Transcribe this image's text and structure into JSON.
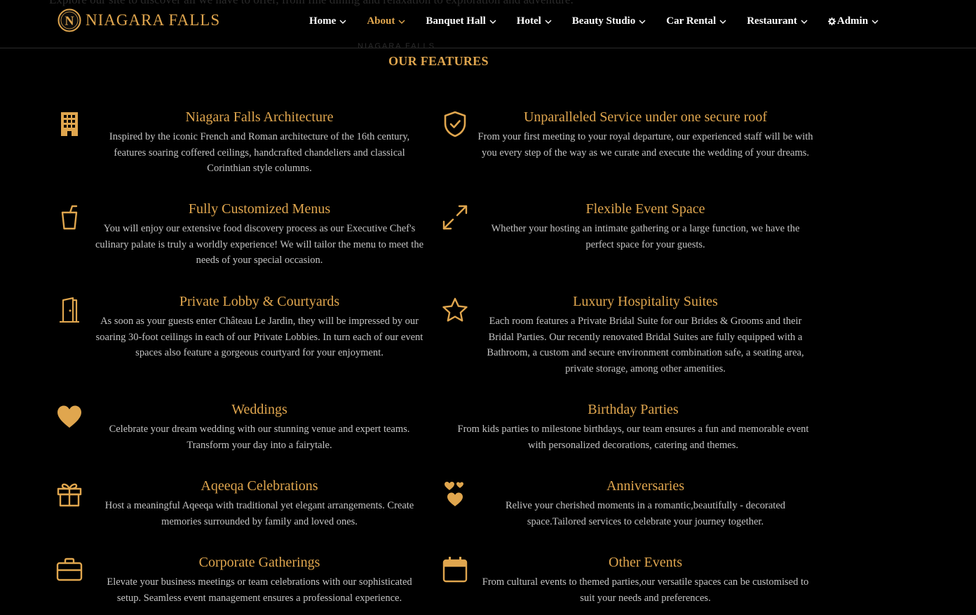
{
  "ghost": {
    "top_text": "Explore our site to discover all we have to offer, from fine dining and relaxation to exploration and adventure.",
    "section_subtitle": "NIAGARA FALLS"
  },
  "brand": {
    "name": "NIAGARA FALLS",
    "logo_letter": "N"
  },
  "nav": [
    {
      "label": "Home"
    },
    {
      "label": "About"
    },
    {
      "label": "Banquet Hall"
    },
    {
      "label": "Hotel"
    },
    {
      "label": "Beauty Studio"
    },
    {
      "label": "Car Rental"
    },
    {
      "label": "Restaurant"
    },
    {
      "label": "Admin"
    }
  ],
  "section": {
    "title": "OUR FEATURES"
  },
  "features": [
    {
      "icon": "building-icon",
      "title": "Niagara Falls Architecture",
      "text": "Inspired by the iconic French and Roman architecture of the 16th century, features soaring coffered ceilings, handcrafted chandeliers and classical Corinthian style columns."
    },
    {
      "icon": "shield-check-icon",
      "title": "Unparalleled Service under one secure roof",
      "text": "From your first meeting to your royal departure, our experienced staff will be with you every step of the way as we curate and execute the wedding of your dreams."
    },
    {
      "icon": "cup-icon",
      "title": "Fully Customized Menus",
      "text": "You will enjoy our extensive food discovery process as our Executive Chef's culinary palate is truly a worldly experience! We will tailor the menu to meet the needs of your special occasion."
    },
    {
      "icon": "expand-arrows-icon",
      "title": "Flexible Event Space",
      "text": "Whether your hosting an intimate gathering or a large function, we have the perfect space for your guests."
    },
    {
      "icon": "door-icon",
      "title": "Private Lobby & Courtyards",
      "text": "As soon as your guests enter Château Le Jardin, they will be impressed by our soaring 30-foot ceilings in each of our Private Lobbies. In turn each of our event spaces also feature a gorgeous courtyard for your enjoyment."
    },
    {
      "icon": "star-icon",
      "title": "Luxury Hospitality Suites",
      "text": "Each room features a Private Bridal Suite for our Brides & Grooms and their Bridal Parties. Our recently renovated Bridal Suites are fully equipped with a Bathroom, a custom and secure environment combination safe, a seating area, private storage, among other amenities."
    },
    {
      "icon": "heart-icon",
      "title": "Weddings",
      "text": "Celebrate your dream wedding with our stunning venue and expert teams. Transform your day into a fairytale."
    },
    {
      "icon": "",
      "title": "Birthday Parties",
      "text": "From kids parties to milestone birthdays, our team ensures a fun and memorable event with personalized decorations, catering and themes."
    },
    {
      "icon": "gift-icon",
      "title": "Aqeeqa Celebrations",
      "text": "Host a meaningful Aqeeqa with traditional yet elegant arrangements. Create memories surrounded by family and loved ones."
    },
    {
      "icon": "hearts-icon",
      "title": "Anniversaries",
      "text": "Relive your cherished moments in a romantic,beautifully - decorated space.Tailored services to celebrate your journey together."
    },
    {
      "icon": "briefcase-icon",
      "title": "Corporate Gatherings",
      "text": "Elevate your business meetings or team celebrations with our sophisticated setup. Seamless event management ensures a professional experience."
    },
    {
      "icon": "calendar-icon",
      "title": "Other Events",
      "text": "From cultural events to themed parties,our versatile spaces can be customised to suit your needs and preferences."
    }
  ],
  "colors": {
    "accent": "#e0a64e",
    "background": "#000000",
    "text": "#c4c4c4",
    "nav_text": "#ffffff"
  }
}
